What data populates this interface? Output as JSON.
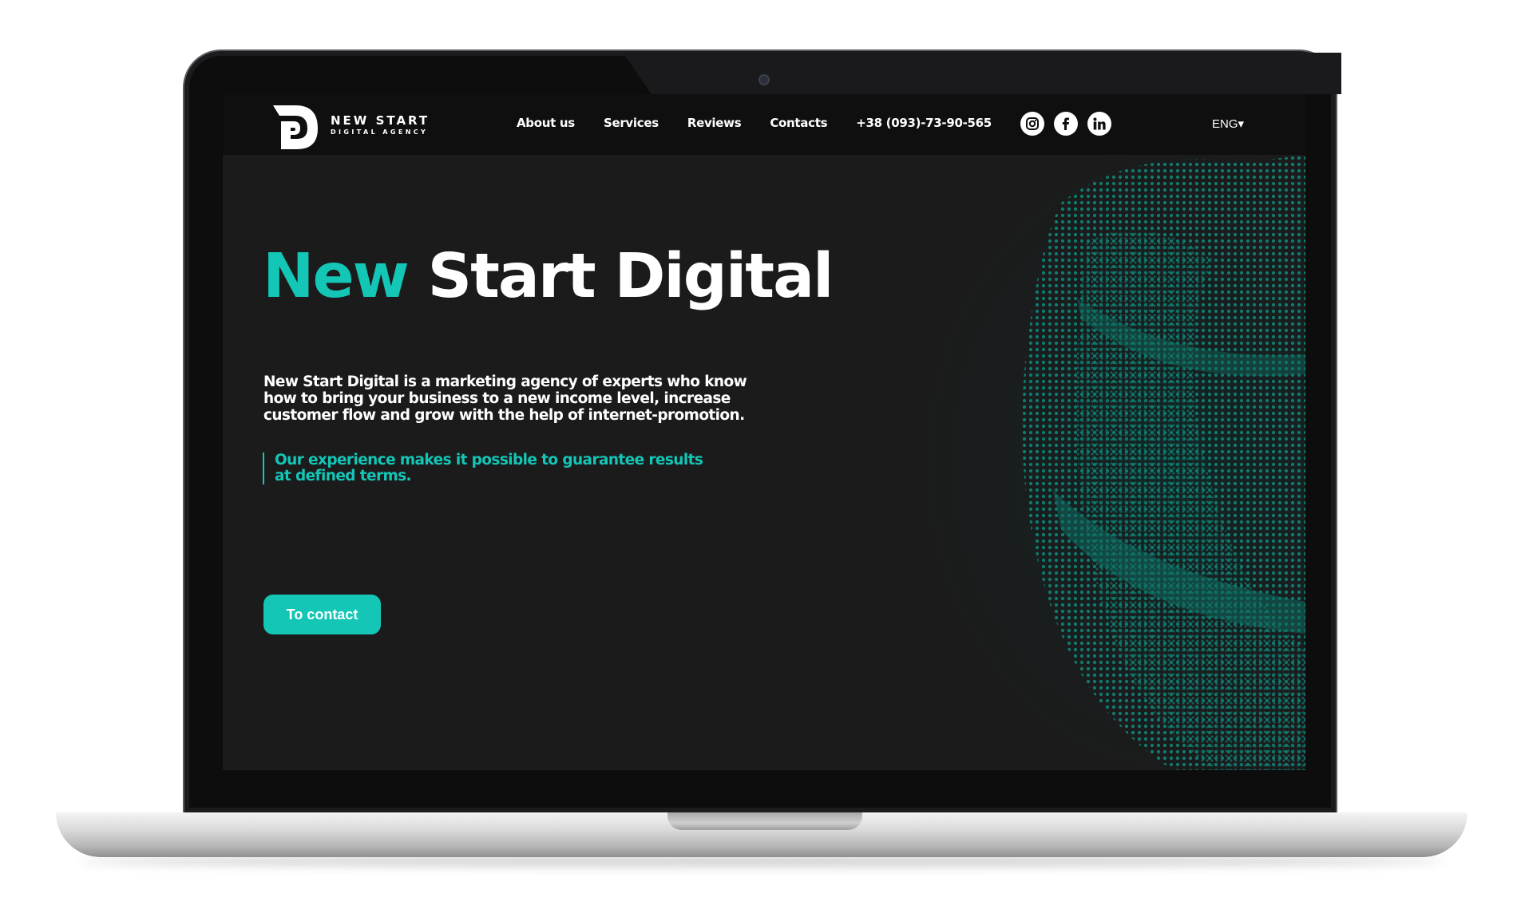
{
  "brand": {
    "name": "NEW START",
    "tagline": "DIGITAL AGENCY"
  },
  "nav": {
    "items": [
      "About us",
      "Services",
      "Reviews",
      "Contacts"
    ],
    "phone": "+38 (093)-73-90-565"
  },
  "socials": {
    "instagram_icon": "instagram-icon",
    "facebook_icon": "facebook-icon",
    "linkedin_icon": "linkedin-icon"
  },
  "language": "ENG▾",
  "hero": {
    "title_accent": "New",
    "title_rest": "Start Digital",
    "description": "New Start Digital is a marketing agency of experts who know how to bring your business to a new income level, increase customer flow and grow with the help of internet-promotion.",
    "quote": "Our experience makes it possible to guarantee results at defined terms.",
    "cta_label": "To contact"
  },
  "colors": {
    "accent": "#13c6b6",
    "background": "#1b1b1c",
    "navbar": "#0f0f10",
    "text": "#ffffff"
  }
}
